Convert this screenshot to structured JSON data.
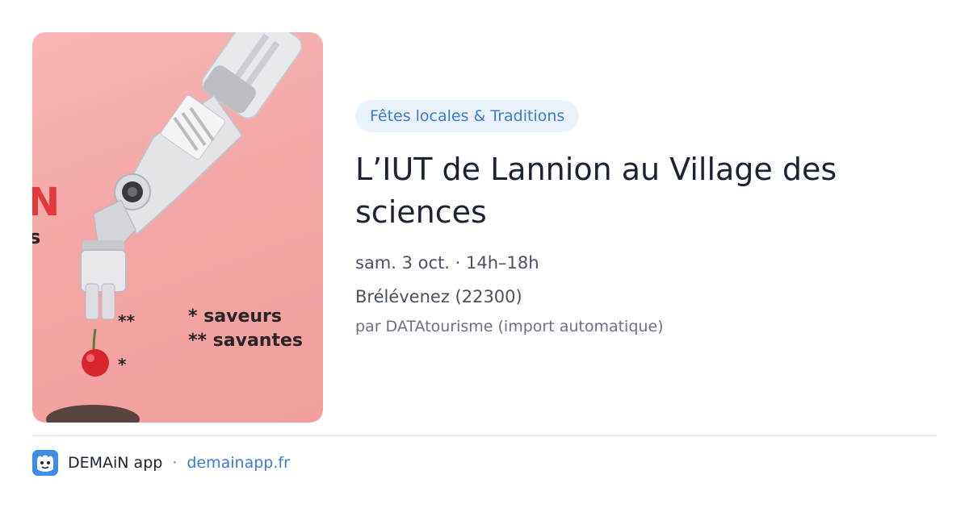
{
  "image": {
    "alt_icon": "robot-arm-cherry-illustration",
    "caption_line1": "* saveurs",
    "caption_line2": "** savantes",
    "marker_double": "**",
    "marker_single": "*",
    "partial_red_letter": "N",
    "partial_dark_letter": "s",
    "colors": {
      "background": "#f3a7a6",
      "cherry": "#d8262c",
      "red_text": "#e23a3a"
    }
  },
  "event": {
    "category": "Fêtes locales & Traditions",
    "title": "L’IUT de Lannion au Village des sciences",
    "date": "sam. 3 oct. · 14h–18h",
    "location": "Brélévenez (22300)",
    "source": "par DATAtourisme (import automatique)"
  },
  "footer": {
    "app_name": "DEMAiN app",
    "separator": "·",
    "site": "demainapp.fr",
    "logo_icon": "demain-app-logo-icon"
  },
  "colors": {
    "accent": "#3b7cd4",
    "chip_bg": "#eaf2fc",
    "title": "#1b2333"
  }
}
